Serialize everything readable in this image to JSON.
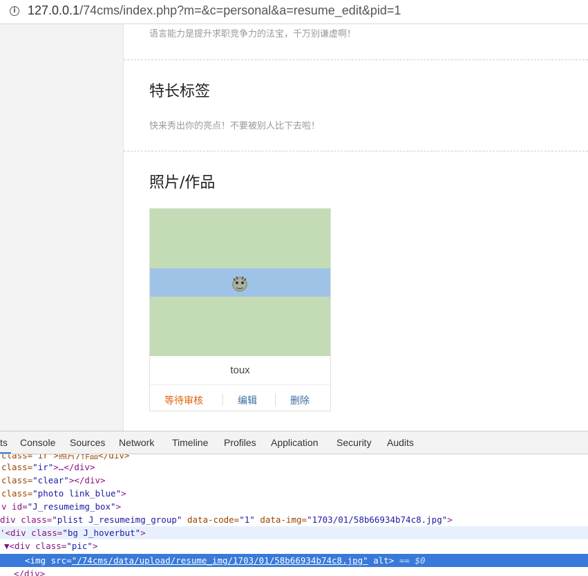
{
  "address_bar": {
    "url_host": "127.0.0.1",
    "url_path": "/74cms/index.php?m=&c=personal&a=resume_edit&pid=1"
  },
  "content": {
    "hint_language": "语言能力是提升求职竞争力的法宝，千万别谦虚啊！",
    "skills_title": "特长标签",
    "skills_hint": "快来秀出你的亮点！不要被别人比下去啦！",
    "photos_title": "照片/作品",
    "photo_card": {
      "name": "toux",
      "status": "等待审核",
      "edit_label": "编辑",
      "delete_label": "删除"
    }
  },
  "devtools": {
    "tabs": [
      "ts",
      "Console",
      "Sources",
      "Network",
      "Timeline",
      "Profiles",
      "Application",
      "Security",
      "Audits"
    ],
    "lines": [
      {
        "prefix": " ",
        "tag_open": "class=\"ir\">照片/作品</div>"
      },
      {
        "text_a": "class=",
        "text_b": "\"ir\"",
        "text_c": ">…</div>"
      },
      {
        "text_a": "class=",
        "text_b": "\"clear\"",
        "text_c": "></div>"
      },
      {
        "text_a": "class=",
        "text_b": "\"photo link_blue\"",
        "text_c": ">"
      },
      {
        "text_a": "v id=",
        "text_b": "\"J_resumeimg_box\"",
        "text_c": ">"
      },
      {
        "text_a": "div class=",
        "text_b": "\"plist J_resumeimg_group\"",
        "text_c": " data-code=",
        "text_d": "\"1\"",
        "text_e": " data-img=",
        "text_f": "\"1703/01/58b66934b74c8.jpg\"",
        "text_g": ">"
      },
      {
        "text_a": "'<div class=",
        "text_b": "\"bg J_hoverbut\"",
        "text_c": ">"
      },
      {
        "text_a": "▼<div class=",
        "text_b": "\"pic\"",
        "text_c": ">"
      },
      {
        "text_a": "<img src=",
        "text_b": "\"/74cms/data/upload/resume_img/1703/01/58b66934b74c8.jpg\"",
        "text_c": " alt>",
        "text_d": " == ",
        "text_e": "$0"
      },
      {
        "text_a": "</div>"
      }
    ]
  }
}
